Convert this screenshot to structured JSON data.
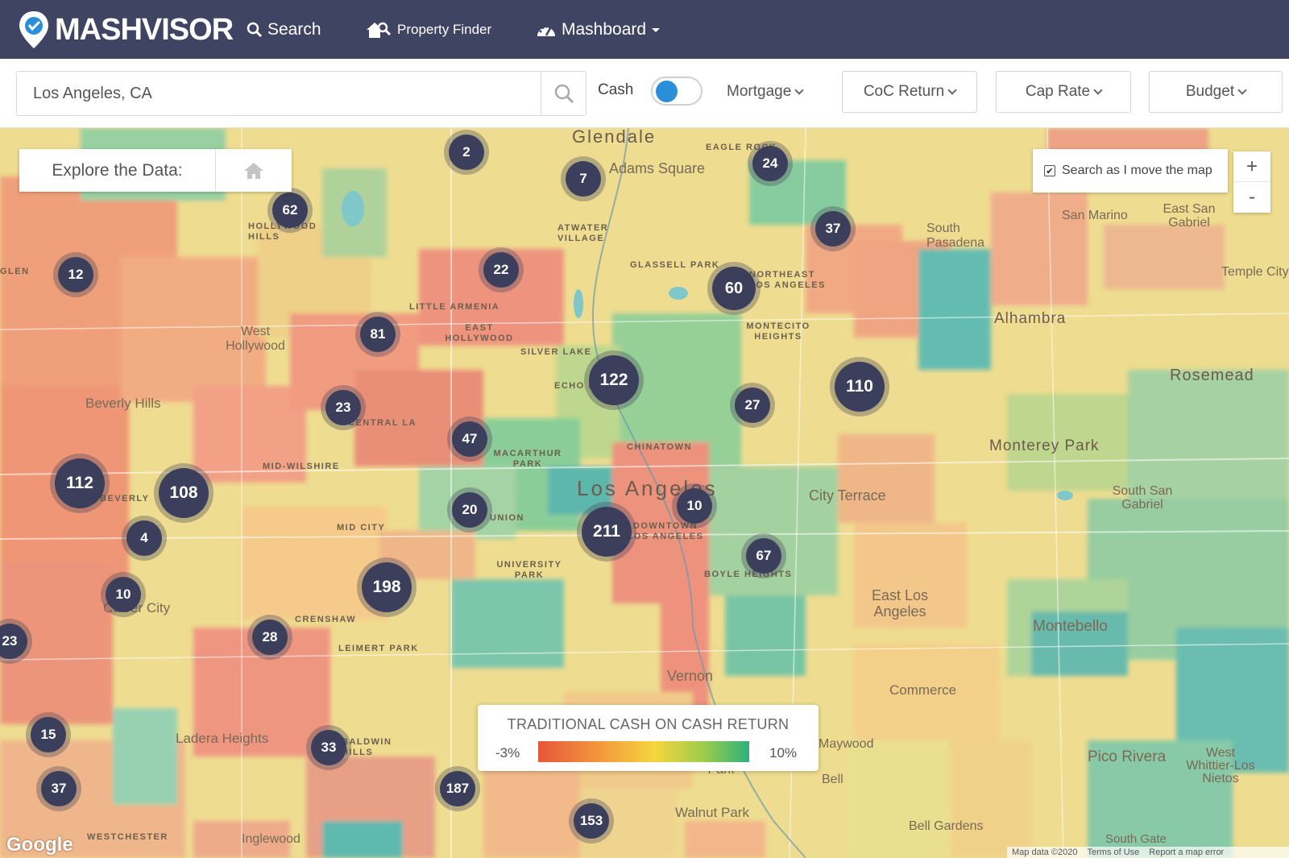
{
  "brand": {
    "name": "MASHVISOR"
  },
  "nav": {
    "search": "Search",
    "property_finder": "Property Finder",
    "mashboard": "Mashboard"
  },
  "filters": {
    "location_value": "Los Angeles, CA",
    "cash_label": "Cash",
    "cash_toggle_state": "on",
    "mortgage": "Mortgage",
    "coc_return": "CoC Return",
    "cap_rate": "Cap Rate",
    "budget": "Budget"
  },
  "map": {
    "explore_label": "Explore the Data:",
    "search_as_move": "Search as I move the map",
    "search_as_move_checked": true,
    "zoom_in": "+",
    "zoom_out": "-",
    "legend": {
      "title": "TRADITIONAL CASH ON CASH RETURN",
      "min": "-3%",
      "max": "10%",
      "gradient_colors": [
        "#e8553a",
        "#f29a3c",
        "#f6d53e",
        "#9fcc4a",
        "#2cb27a"
      ]
    },
    "places": [
      "Glendale",
      "EAGLE ROCK",
      "Adams Square",
      "ATWATER VILLAGE",
      "HOLLYWOOD HILLS",
      "GLEN",
      "South Pasadena",
      "San Marino",
      "East San Gabriel",
      "Temple City",
      "GLASSELL PARK",
      "NORTHEAST LOS ANGELES",
      "LITTLE ARMENIA",
      "EAST HOLLYWOOD",
      "West Hollywood",
      "Alhambra",
      "MONTECITO HEIGHTS",
      "SILVER LAKE",
      "Beverly Hills",
      "Rosemead",
      "CENTRAL LA",
      "ECHO PARK",
      "Monterey Park",
      "CHINATOWN",
      "MID-WILSHIRE",
      "MACARTHUR PARK",
      "Los Angeles",
      "City Terrace",
      "South San Gabriel",
      "BEVERLY",
      "MID CITY",
      "UNION",
      "DOWNTOWN LOS ANGELES",
      "UNIVERSITY PARK",
      "BOYLE HEIGHTS",
      "East Los Angeles",
      "Montebello",
      "Culver City",
      "CRENSHAW",
      "LEIMERT PARK",
      "Vernon",
      "Commerce",
      "Ladera Heights",
      "BALDWIN HILLS",
      "Huntington Park",
      "Maywood",
      "Bell",
      "Pico Rivera",
      "West Whittier-Los Nietos",
      "Walnut Park",
      "Bell Gardens",
      "WESTCHESTER",
      "Inglewood",
      "South Gate"
    ],
    "clusters": [
      "2",
      "7",
      "24",
      "62",
      "37",
      "12",
      "22",
      "60",
      "81",
      "122",
      "110",
      "23",
      "27",
      "47",
      "112",
      "108",
      "10",
      "4",
      "20",
      "211",
      "67",
      "198",
      "10",
      "28",
      "15",
      "33",
      "187",
      "37",
      "153",
      "23"
    ],
    "attribution": {
      "google": "Google",
      "map_data": "Map data ©2020",
      "terms": "Terms of Use",
      "report": "Report a map error"
    }
  }
}
